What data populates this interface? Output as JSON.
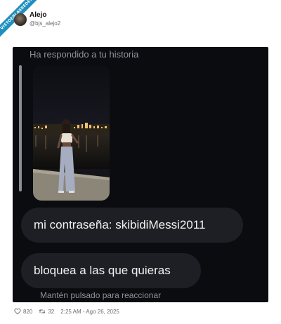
{
  "watermark": {
    "text": "VISTOENLASREDES"
  },
  "tweet": {
    "user_name": "Alejo",
    "user_handle": "@bjs_alejo2",
    "likes": "820",
    "retweets": "32",
    "timestamp": "2:25 AM - Ago 26, 2025"
  },
  "screenshot": {
    "replied_label": "Ha respondido a tu historia",
    "messages": [
      "mi contraseña: skibidiMessi2011",
      "bloquea a las que quieras"
    ],
    "hint": "Mantén pulsado para reaccionar"
  },
  "icons": {
    "like": "heart-icon",
    "retweet": "retweet-icon"
  },
  "colors": {
    "chat_background": "#0b0c10",
    "bubble": "#1e1f24",
    "watermark": "#1f8fbf"
  }
}
